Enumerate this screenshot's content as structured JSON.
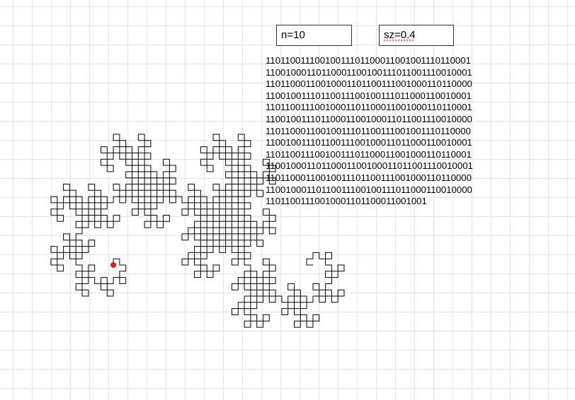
{
  "controls": {
    "n_value": "n=10",
    "sz_value": "sz=0.4"
  },
  "bit_lines": [
    "11011001110010011101100011001001110110001",
    "11001000110110001100100111011001110010001",
    "11011000110010001101100111001000110110000",
    "11001001110110011100100111011000110010001",
    "11011001110010001101100011001000110110001",
    "11001001110110001100100011011001110010000",
    "11011000110010011101100111001001110110000",
    "11001001110110011100100011011000110010001",
    "11011001110010011101100011001000110110001",
    "11001000110110001100100011011001110010001",
    "11011000110010011101100111001000110110000",
    "11001000110110011100100111011000110010000",
    "1101100111001000110110001100100 1"
  ],
  "curve": {
    "iterations": 10,
    "line_color": "#000000",
    "start_marker_color": "#e0201c"
  }
}
